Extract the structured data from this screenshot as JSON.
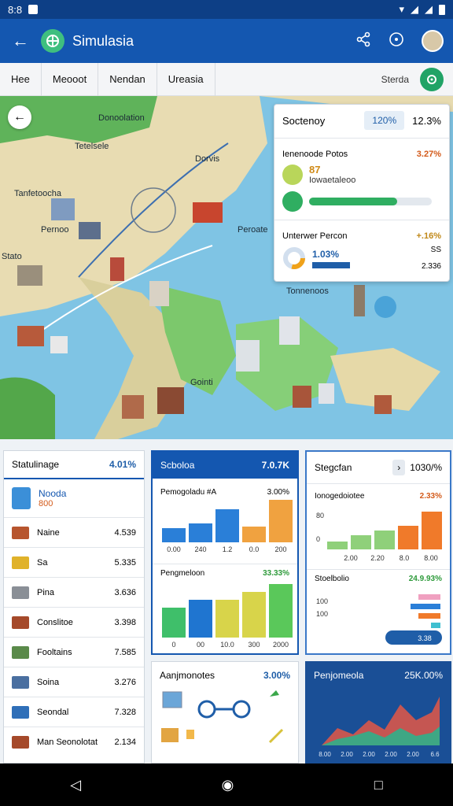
{
  "status": {
    "time": "8:8",
    "icons": [
      "wifi-icon",
      "signal-icon",
      "signal-icon",
      "battery-icon"
    ]
  },
  "appbar": {
    "title": "Simulasia"
  },
  "tabs": [
    "Hee",
    "Meooot",
    "Nendan",
    "Ureasia"
  ],
  "tabs_right": "Sterda",
  "map": {
    "labels": [
      "Donoolation",
      "Tetelsele",
      "Dorvis",
      "Tanfetoocha",
      "Pernoo",
      "Peroate",
      "Stato",
      "Tonnenoos",
      "Gointi"
    ]
  },
  "overlay": {
    "title": "Soctenoy",
    "pill": "120%",
    "pill_val": "12.3%",
    "row2_label": "Ienenoode Potos",
    "row2_val": "3.27%",
    "row3_big": "87",
    "row3_text": "Iowaetaleoo",
    "row3_progress": 0.72,
    "row4_label": "Unterwer Percon",
    "row4_val": "+.16%",
    "row5_big": "1.03%",
    "row5_s1": "SS",
    "row5_s2": "2.336"
  },
  "card1": {
    "title": "Statulinage",
    "value": "4.01%",
    "top_title": "Nooda",
    "top_val": "800",
    "rows": [
      {
        "label": "Naine",
        "num": "4.539"
      },
      {
        "label": "Sa",
        "num": "5.335"
      },
      {
        "label": "Pina",
        "num": "3.636"
      },
      {
        "label": "Conslitoe",
        "num": "3.398"
      },
      {
        "label": "Fooltains",
        "num": "7.585"
      },
      {
        "label": "Soina",
        "num": "3.276"
      },
      {
        "label": "Seondal",
        "num": "7.328"
      },
      {
        "label": "Man Seonolotat",
        "num": "2.134"
      }
    ]
  },
  "card2": {
    "title": "Scboloa",
    "value": "7.0.7K",
    "sub1": "Pemogoladu #A",
    "sub1_val": "3.00%",
    "sub1_ticks": [
      "0.00",
      "240",
      "1.2",
      "0.0",
      "200"
    ],
    "sub2": "Pengmeloon",
    "sub2_val": "33.33%",
    "sub2_ticks": [
      "0",
      "00",
      "10.0",
      "300",
      "2000"
    ]
  },
  "card3": {
    "title": "Stegcfan",
    "value": "1030/%",
    "sub1": "Ionogedoiotee",
    "sub1_val": "2.33%",
    "sub1_ylab": [
      "80",
      "0"
    ],
    "sub1_ticks": [
      "2.00",
      "2.20",
      "8.0",
      "8.00"
    ],
    "sub2": "Stoelbolio",
    "sub2_val": "24.9.93%",
    "sub2_ylab": [
      "100",
      "100"
    ],
    "sub2_btn": "3.38"
  },
  "card4": {
    "title": "Aanjmonotes",
    "value": "3.00%"
  },
  "card5": {
    "title": "Penjomeola",
    "value": "25K.00%",
    "ticks": [
      "8.00",
      "2.00",
      "2.00",
      "2.00",
      "2.00",
      "6.6"
    ]
  }
}
